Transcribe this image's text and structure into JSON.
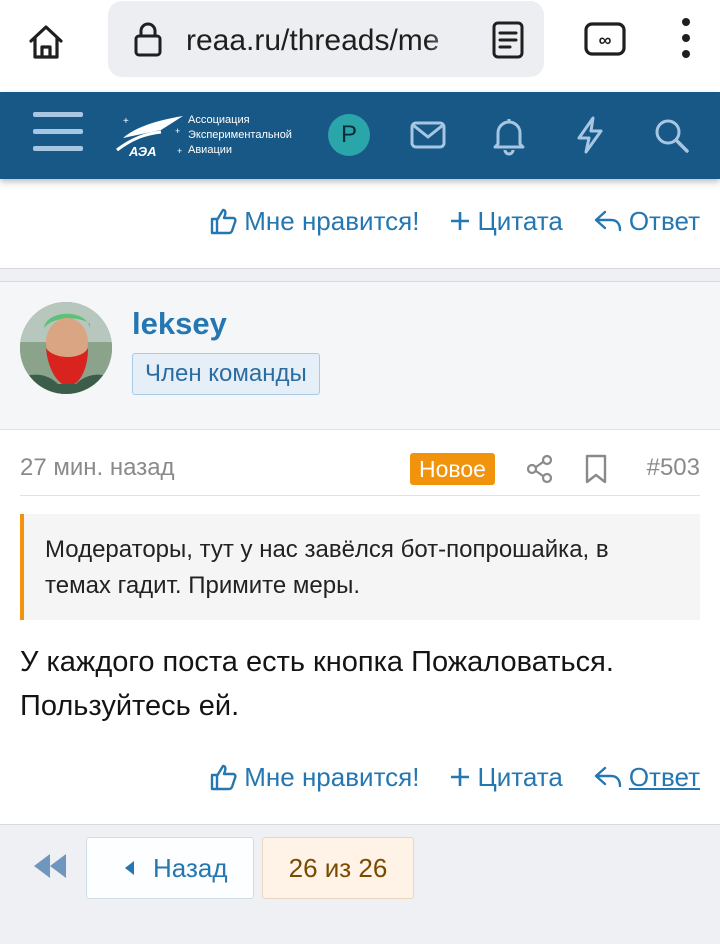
{
  "browser": {
    "url": "reaa.ru/threads/me"
  },
  "header": {
    "logo_lines": [
      "Ассоциация",
      "Экспериментальной",
      "Авиации"
    ],
    "logo_mark": "АЭА",
    "user_initial": "P"
  },
  "post_actions": {
    "like_label": "Мне нравится!",
    "quote_label": "Цитата",
    "reply_label": "Ответ"
  },
  "post": {
    "author": "leksey",
    "role": "Член команды",
    "time": "27 мин. назад",
    "new_badge": "Новое",
    "number": "#503",
    "quote_text": "Модераторы, тут у нас завёлся бот-попрошайка, в темах гадит. Примите меры.",
    "body_text": "У каждого поста есть кнопка Пожаловаться. Пользуйтесь ей."
  },
  "pagination": {
    "prev_label": "Назад",
    "counter": "26 из 26"
  },
  "colors": {
    "header_bg": "#185886",
    "link": "#2577b1",
    "accent_orange": "#f2930d"
  }
}
